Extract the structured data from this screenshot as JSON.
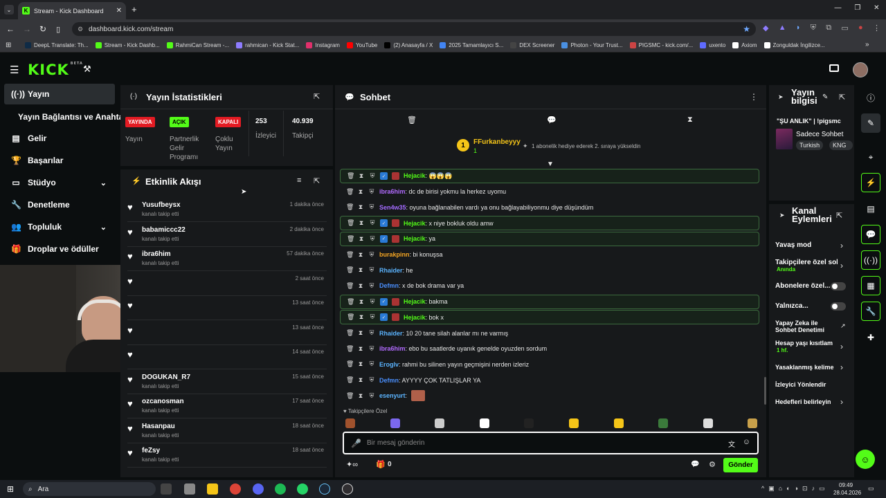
{
  "browser": {
    "tab_title": "Stream - Kick Dashboard",
    "url": "dashboard.kick.com/stream",
    "bookmarks": [
      "DeepL Translate: Th...",
      "Stream - Kick Dashb...",
      "RahmiCan Stream -...",
      "rahmican - Kick Stat...",
      "Instagram",
      "YouTube",
      "(2) Anasayfa / X",
      "2025 Tamamlayıcı S...",
      "DEX Screener",
      "Photon - Your Trust...",
      "PIGSMC - kick.com/...",
      "uxento",
      "Axiom",
      "Zonguldak İngilizce..."
    ]
  },
  "app": {
    "logo": "KICK",
    "beta": "BETA"
  },
  "sidebar": {
    "items": [
      {
        "label": "Yayın",
        "icon": "broadcast-icon"
      },
      {
        "label": "Yayın Bağlantısı ve Anahtarı"
      },
      {
        "label": "Gelir",
        "icon": "wallet-icon"
      },
      {
        "label": "Başarılar",
        "icon": "trophy-icon"
      },
      {
        "label": "Stüdyo",
        "icon": "studio-icon"
      },
      {
        "label": "Denetleme",
        "icon": "wrench-icon"
      },
      {
        "label": "Topluluk",
        "icon": "users-icon"
      },
      {
        "label": "Droplar ve ödüller",
        "icon": "gift-icon"
      }
    ]
  },
  "stats": {
    "title": "Yayın İstatistikleri",
    "yayin_badge": "YAYINDA",
    "yayin_label": "Yayın",
    "partner_badge": "AÇIK",
    "partner_label": "Partnerlik Gelir Programı",
    "multi_badge": "KAPALI",
    "multi_label": "Çoklu Yayın",
    "viewers": "253",
    "viewers_label": "İzleyici",
    "followers": "40.939",
    "followers_label": "Takipçi"
  },
  "feed": {
    "title": "Etkinlik Akışı",
    "items": [
      {
        "name": "Yusufbeysx",
        "sub": "kanalı takip etti",
        "time": "1 dakika önce"
      },
      {
        "name": "babamiccc22",
        "sub": "kanalı takip etti",
        "time": "2 dakika önce"
      },
      {
        "name": "ibra6him",
        "sub": "kanalı takip etti",
        "time": "57 dakika önce"
      },
      {
        "name": "",
        "sub": "",
        "time": "2 saat önce"
      },
      {
        "name": "",
        "sub": "",
        "time": "13 saat önce"
      },
      {
        "name": "",
        "sub": "",
        "time": "13 saat önce"
      },
      {
        "name": "",
        "sub": "",
        "time": "14 saat önce"
      },
      {
        "name": "DOGUKAN_R7",
        "sub": "kanalı takip etti",
        "time": "15 saat önce"
      },
      {
        "name": "ozcanosman",
        "sub": "kanalı takip etti",
        "time": "17 saat önce"
      },
      {
        "name": "Hasanpau",
        "sub": "kanalı takip etti",
        "time": "18 saat önce"
      },
      {
        "name": "feZsy",
        "sub": "kanalı takip etti",
        "time": "18 saat önce"
      }
    ]
  },
  "chat": {
    "title": "Sohbet",
    "gift_rank": "1",
    "gift_user": "FFurkanbeyyy",
    "gift_count": "1",
    "gift_text": "1 abonelik hediye ederek 2. sıraya yükseldin",
    "messages": [
      {
        "user": "Hejacik",
        "text": "😱😱😱",
        "color": "#53fc18",
        "hl": true,
        "badges": true
      },
      {
        "user": "ibra6him",
        "text": "dc de birisi yokmu la herkez uyomu",
        "color": "#b26bff",
        "hl": false
      },
      {
        "user": "Sen4w35",
        "text": "oyuna bağlanabilen vardı ya onu bağlayabiliyonmu diye düşündüm",
        "color": "#a36bff",
        "hl": false
      },
      {
        "user": "Hejacik",
        "text": "x niye bokluk oldu amw",
        "color": "#53fc18",
        "hl": true,
        "badges": true
      },
      {
        "user": "Hejacik",
        "text": "ya",
        "color": "#53fc18",
        "hl": true,
        "badges": true
      },
      {
        "user": "burakpinn",
        "text": "bi konuşsa",
        "color": "#f5a623",
        "hl": false
      },
      {
        "user": "Rhaider",
        "text": "he",
        "color": "#5bb4ff",
        "hl": false
      },
      {
        "user": "Defmn",
        "text": "x de bok drama var ya",
        "color": "#4a90ff",
        "hl": false
      },
      {
        "user": "Hejacik",
        "text": "bakma",
        "color": "#53fc18",
        "hl": true,
        "badges": true
      },
      {
        "user": "Hejacik",
        "text": "bok x",
        "color": "#53fc18",
        "hl": true,
        "badges": true
      },
      {
        "user": "Rhaider",
        "text": "10 20 tane silah alanlar mı ne varmış",
        "color": "#5bb4ff",
        "hl": false
      },
      {
        "user": "ibra6him",
        "text": "ebo bu saatlerde uyanık genelde oyuzden sordum",
        "color": "#b26bff",
        "hl": false
      },
      {
        "user": "Eroglv",
        "text": "rahmi bu silinen yayın geçmişini nerden izleriz",
        "color": "#5bb4ff",
        "hl": false
      },
      {
        "user": "Defmn",
        "text": "AYYYY ÇOK TATLIŞLAR YA",
        "color": "#4a90ff",
        "hl": false
      },
      {
        "user": "esenyurt",
        "text": "",
        "color": "#5bb4ff",
        "hl": false,
        "emote": true
      }
    ],
    "follower_emotes_label": "Takipçilere Özel",
    "input_placeholder": "Bir mesaj gönderin",
    "points": "0",
    "send_label": "Gönder"
  },
  "stream_info": {
    "title": "Yayın bilgisi",
    "stream_title": "\"ŞU ANLIK\" | !pigsmc",
    "category": "Sadece Sohbet",
    "tag1": "Turkish",
    "tag2": "KNG"
  },
  "channel_actions": {
    "title": "Kanal Eylemleri",
    "slow_mode": "Yavaş mod",
    "followers_only": "Takipçilere özel soh",
    "followers_only_sub": "Anında",
    "subs_only": "Abonelere özel...",
    "emotes_only": "Yalnızca...",
    "ai_mod": "Yapay Zeka ile Sohbet Denetimi",
    "account_age": "Hesap yaşı kısıtlam",
    "account_age_sub": "1 hf.",
    "banned_words": "Yasaklanmış kelime",
    "raid": "İzleyici Yönlendir",
    "goals": "Hedefleri belirleyin"
  },
  "taskbar": {
    "search": "Ara",
    "time": "09:49",
    "date": "28.04.2026"
  }
}
